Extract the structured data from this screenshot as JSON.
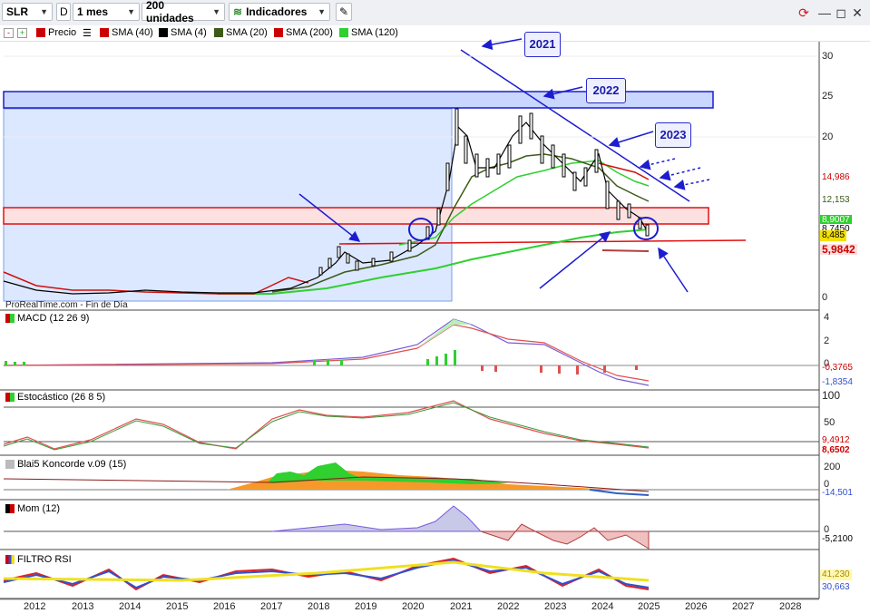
{
  "toolbar": {
    "symbol": "SLR",
    "period_letter": "D",
    "timeframe": "1 mes",
    "units": "200 unidades",
    "indicators": "Indicadores"
  },
  "legend": {
    "price": "Precio",
    "sma40": "SMA (40)",
    "sma4": "SMA (4)",
    "sma20": "SMA (20)",
    "sma200": "SMA (200)",
    "sma120": "SMA (120)"
  },
  "price_axis": [
    "30",
    "25",
    "20",
    "15",
    "0"
  ],
  "price_tags": {
    "a": "14,986",
    "b": "12,153",
    "c": "8,9007",
    "d": "8,7450",
    "e": "8,485",
    "f": "5,9842"
  },
  "source": "ProRealTime.com - Fin de Día",
  "annotations": {
    "y2021": "2021",
    "y2022": "2022",
    "y2023": "2023"
  },
  "panels": {
    "macd": {
      "label": "MACD (12 26 9)",
      "axis": [
        "4",
        "2",
        "0"
      ],
      "tags": [
        "-0,3765",
        "-1,8354"
      ]
    },
    "stoch": {
      "label": "Estocástico (26 8 5)",
      "axis": [
        "100",
        "50"
      ],
      "tags": [
        "9,4912",
        "8,6502"
      ]
    },
    "koncorde": {
      "label": "Blai5 Koncorde v.09 (15)",
      "axis": [
        "200",
        "0"
      ],
      "tags": [
        "-14,501"
      ]
    },
    "mom": {
      "label": "Mom (12)",
      "axis": [
        "0"
      ],
      "tags": [
        "-5,2100"
      ]
    },
    "rsi": {
      "label": "FILTRO RSI",
      "axis": [],
      "tags": [
        "41,230",
        "30,663"
      ]
    }
  },
  "x_axis": [
    "2012",
    "2013",
    "2014",
    "2015",
    "2016",
    "2017",
    "2018",
    "2019",
    "2020",
    "2021",
    "2022",
    "2023",
    "2024",
    "2025",
    "2026",
    "2027",
    "2028"
  ],
  "colors": {
    "accent": "#1c1cd0",
    "price_red": "#d01010",
    "sma_green": "#2fd02f",
    "sma_dark": "#3d5a1a"
  }
}
